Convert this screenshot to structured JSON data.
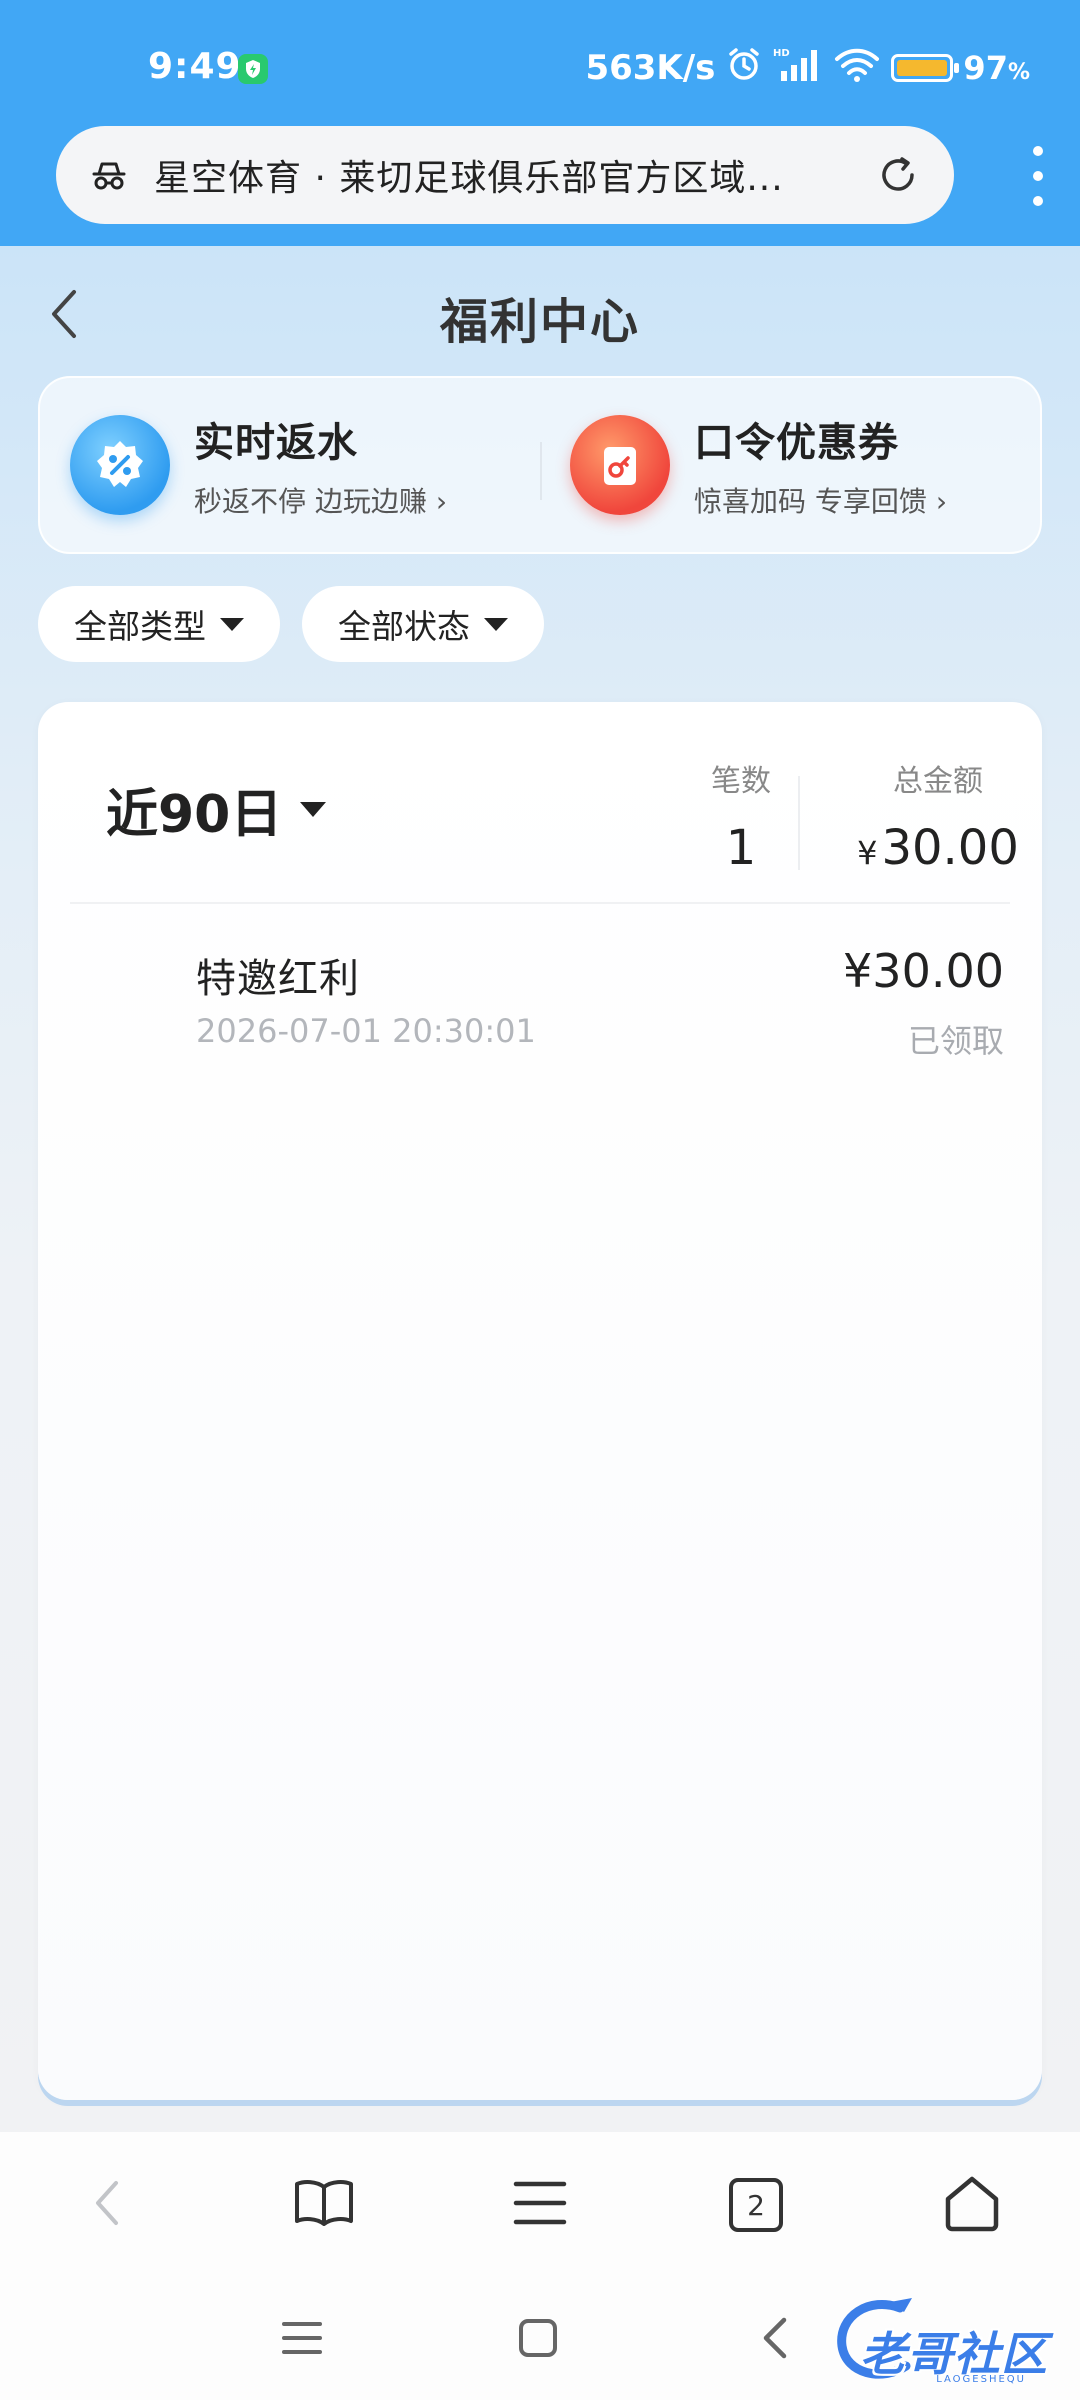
{
  "status_bar": {
    "time": "9:49",
    "net_speed": "563K/s",
    "battery_pct": "97",
    "battery_unit": "%"
  },
  "browser": {
    "url_title": "星空体育 · 莱切足球俱乐部官方区域...",
    "tab_count": "2"
  },
  "page": {
    "title": "福利中心"
  },
  "promos": [
    {
      "title": "实时返水",
      "subtitle": "秒返不停 边玩边赚",
      "icon": "percent-badge-icon",
      "color": "#2f9cf0"
    },
    {
      "title": "口令优惠券",
      "subtitle": "惊喜加码 专享回馈",
      "icon": "coupon-key-icon",
      "color": "#f0463c"
    }
  ],
  "filters": [
    {
      "label": "全部类型"
    },
    {
      "label": "全部状态"
    }
  ],
  "summary": {
    "period": "近90日",
    "count_label": "笔数",
    "count_value": "1",
    "total_label": "总金额",
    "total_currency": "¥",
    "total_value": "30.00"
  },
  "records": [
    {
      "title": "特邀红利",
      "time": "2026-07-01 20:30:01",
      "amount": "¥30.00",
      "status": "已领取"
    }
  ],
  "watermark": {
    "text": "老哥社区",
    "sub": "LAOGESHEQU"
  },
  "colors": {
    "status_bar_bg": "#41a7f5",
    "watermark": "#3b7ee8"
  }
}
